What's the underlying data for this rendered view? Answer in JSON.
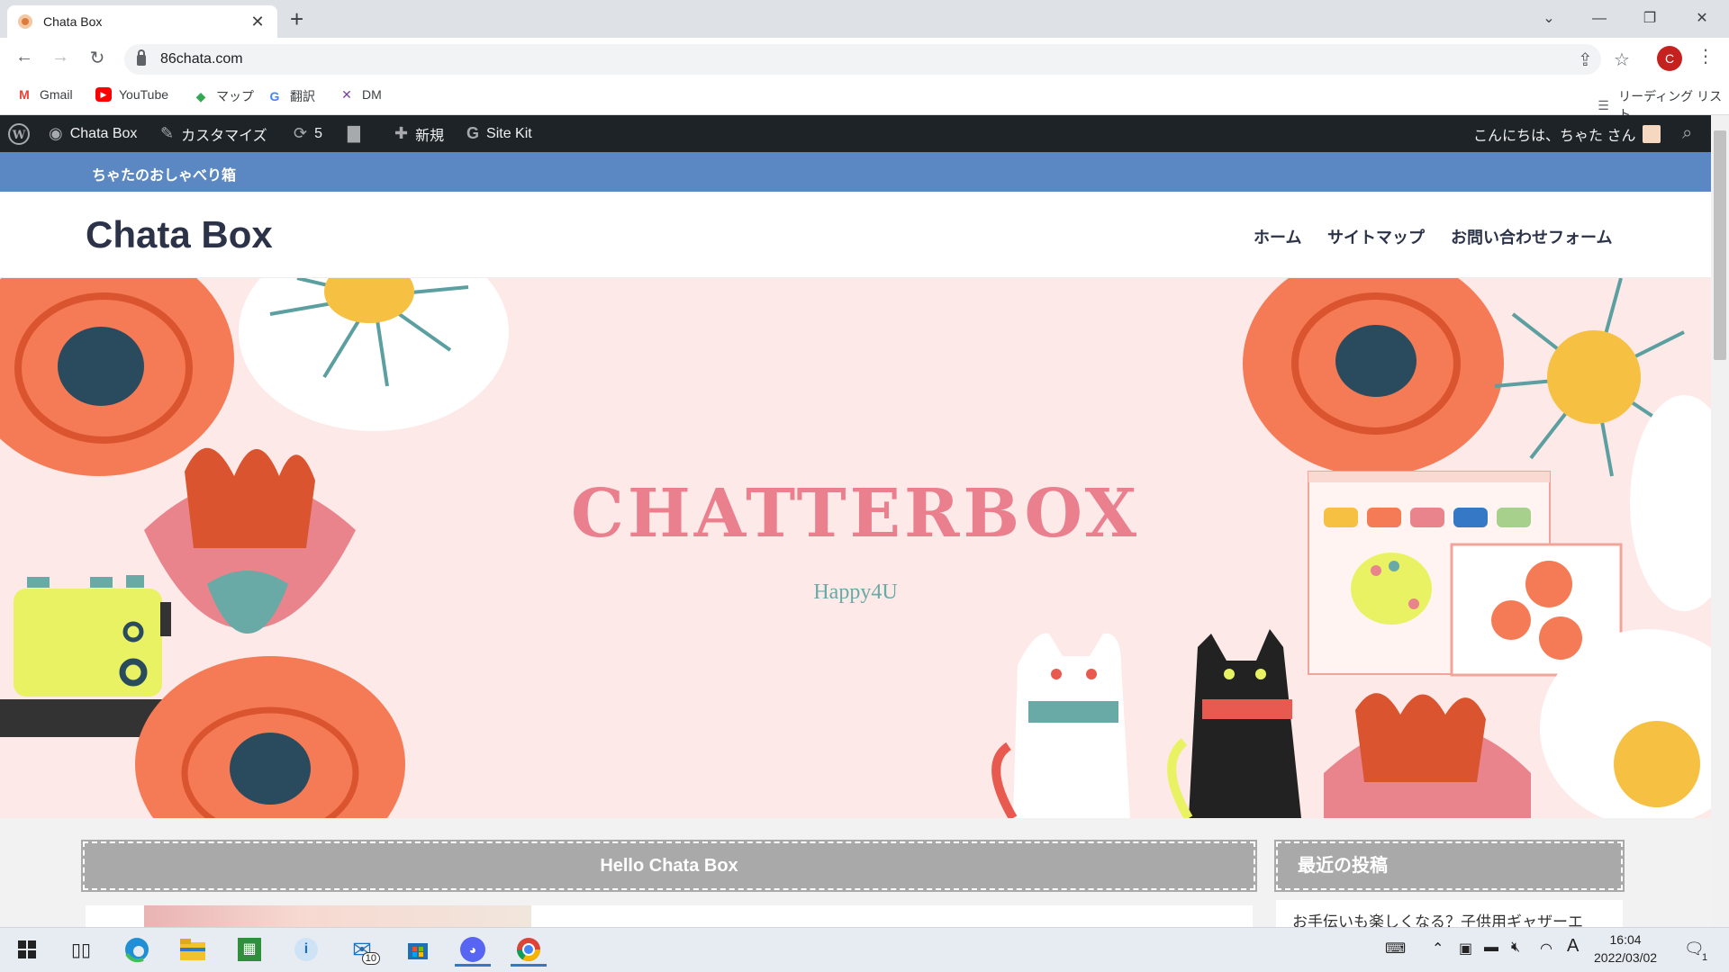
{
  "browser": {
    "tab_title": "Chata Box",
    "tab_close": "✕",
    "new_tab": "+",
    "url": "86chata.com",
    "profile_initial": "C",
    "bookmarks": [
      {
        "label": "Gmail",
        "icon": "gmail-icon"
      },
      {
        "label": "YouTube",
        "icon": "youtube-icon"
      },
      {
        "label": "マップ",
        "icon": "maps-icon"
      },
      {
        "label": "翻訳",
        "icon": "translate-icon"
      },
      {
        "label": "DM",
        "icon": "dm-icon"
      }
    ],
    "reading_list": "リーディング リスト"
  },
  "adminbar": {
    "site_name": "Chata Box",
    "customize": "カスタマイズ",
    "updates_count": "5",
    "new_label": "新規",
    "sitekit": "Site Kit",
    "greeting": "こんにちは、ちゃた さん"
  },
  "site": {
    "tagline": "ちゃたのおしゃべり箱",
    "title": "Chata Box",
    "nav": [
      "ホーム",
      "サイトマップ",
      "お問い合わせフォーム"
    ],
    "hero_title": "CHATTERBOX",
    "hero_subtitle": "Happy4U",
    "main_heading": "Hello Chata Box",
    "sidebar_heading": "最近の投稿",
    "recent_post_1": "お手伝いも楽しくなる？子供用ギャザーエ"
  },
  "taskbar": {
    "mail_badge": "10",
    "time": "16:04",
    "date": "2022/03/02",
    "ime": "A",
    "notification_count": "1"
  },
  "colors": {
    "admin_bg": "#1d2327",
    "topbar_bg": "#5b87c3",
    "hero_bg": "#fde9e7",
    "hero_title": "#ea7f8e",
    "title_color": "#2c3349",
    "heading_bg": "#a9a9a9"
  }
}
